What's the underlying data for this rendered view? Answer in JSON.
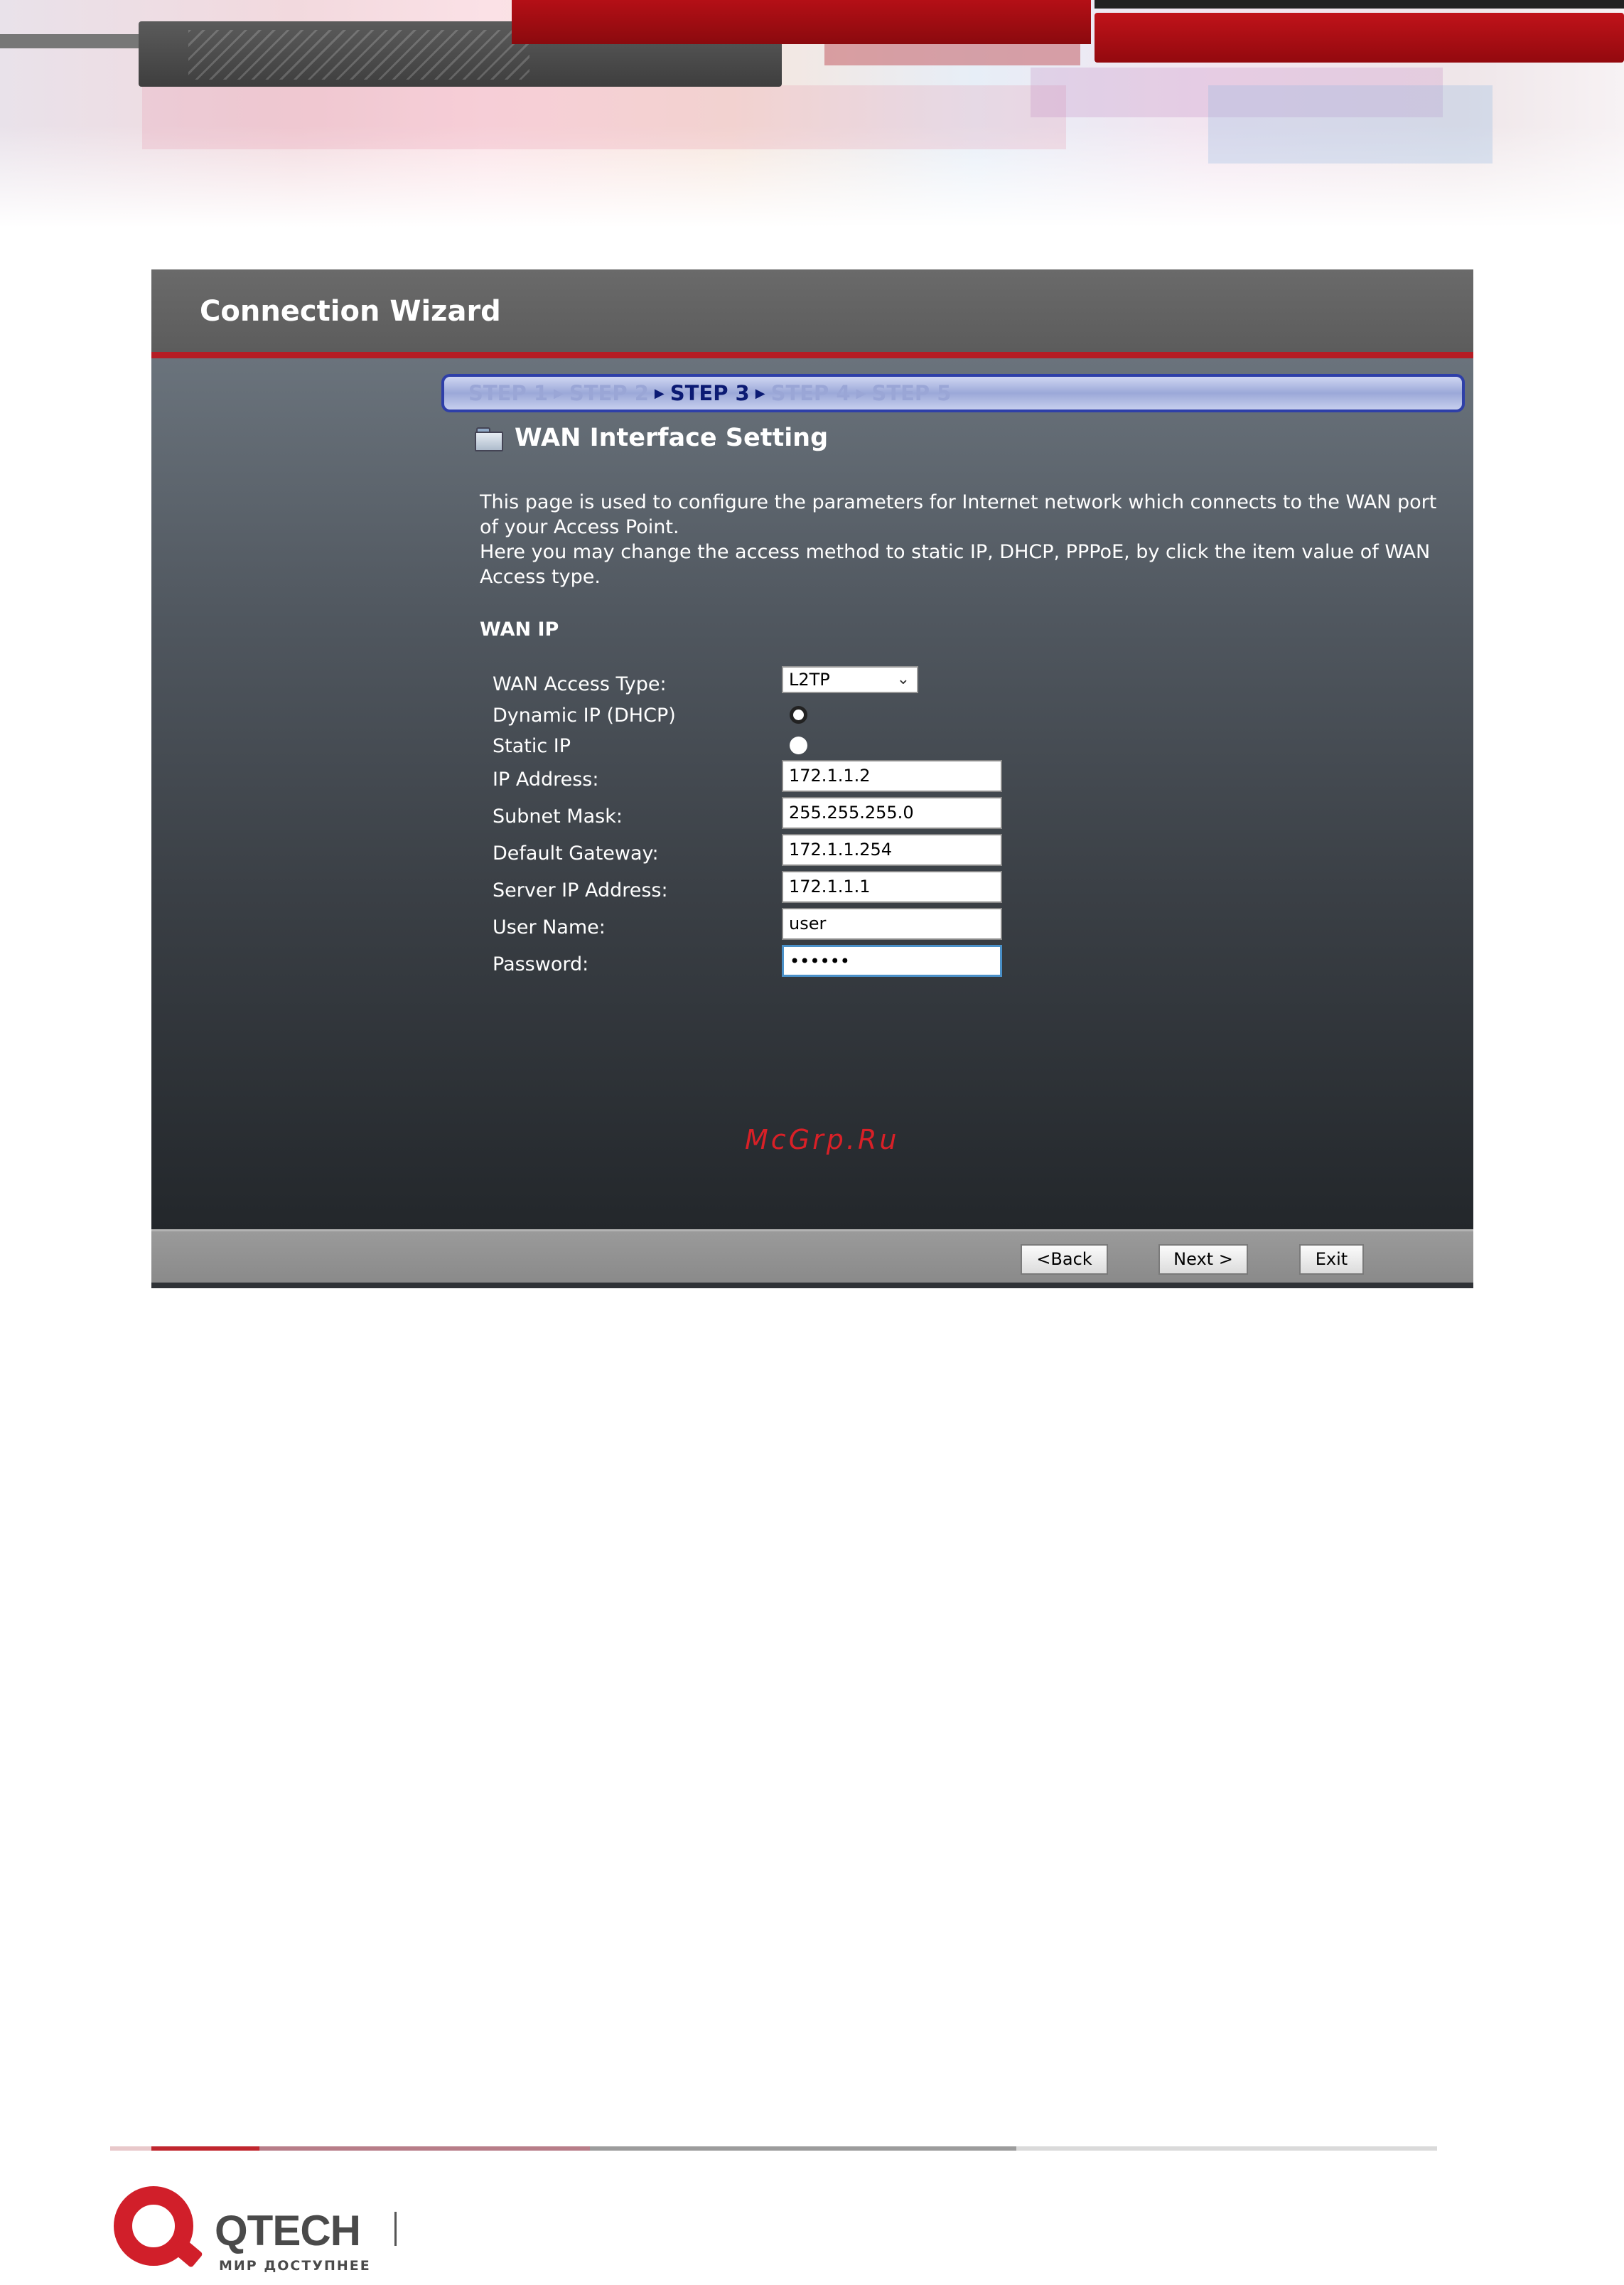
{
  "wizard": {
    "title": "Connection Wizard",
    "steps": [
      {
        "label": "STEP 1",
        "active": false
      },
      {
        "label": "STEP 2",
        "active": false
      },
      {
        "label": "STEP 3",
        "active": true
      },
      {
        "label": "STEP 4",
        "active": false
      },
      {
        "label": "STEP 5",
        "active": false
      }
    ],
    "heading": "WAN Interface Setting",
    "description": [
      "This page is used to configure the parameters for Internet network which connects to the WAN port of your Access Point.",
      "Here you may change the access method to static IP, DHCP, PPPoE, by click the item value of WAN Access type."
    ],
    "section_title": "WAN IP",
    "form": {
      "access_type_label": "WAN Access Type:",
      "access_type_value": "L2TP",
      "dhcp_label": "Dynamic IP (DHCP)",
      "dhcp_selected": true,
      "static_label": "Static IP",
      "static_selected": false,
      "ip_label": "IP Address:",
      "ip_value": "172.1.1.2",
      "mask_label": "Subnet Mask:",
      "mask_value": "255.255.255.0",
      "gateway_label": "Default Gateway:",
      "gateway_value": "172.1.1.254",
      "server_label": "Server IP Address:",
      "server_value": "172.1.1.1",
      "user_label": "User Name:",
      "user_value": "user",
      "password_label": "Password:",
      "password_value": "••••••"
    },
    "watermark": "McGrp.Ru",
    "buttons": {
      "back": "<Back",
      "next": "Next >",
      "exit": "Exit"
    }
  },
  "brand": {
    "name": "QTECH",
    "tagline": "МИР ДОСТУПНЕЕ",
    "accent_color": "#d11f2a"
  }
}
